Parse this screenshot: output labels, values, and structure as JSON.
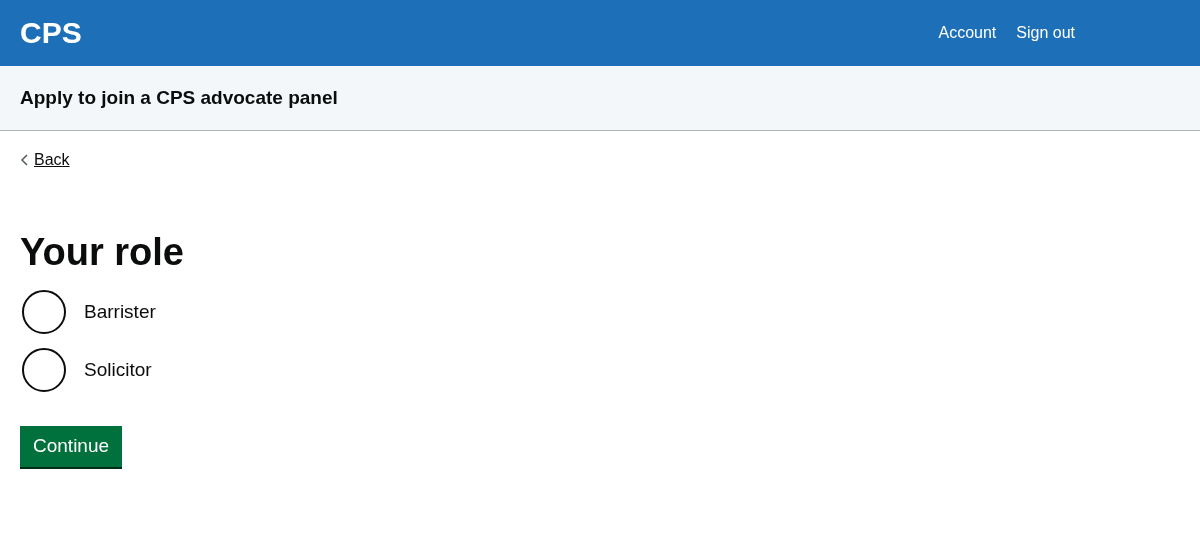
{
  "header": {
    "logo": "CPS",
    "links": [
      "Account",
      "Sign out"
    ]
  },
  "service_bar": {
    "title": "Apply to join a CPS advocate panel"
  },
  "back_link": "Back",
  "heading": "Your role",
  "options": [
    {
      "label": "Barrister",
      "selected": false
    },
    {
      "label": "Solicitor",
      "selected": false
    }
  ],
  "button": "Continue"
}
